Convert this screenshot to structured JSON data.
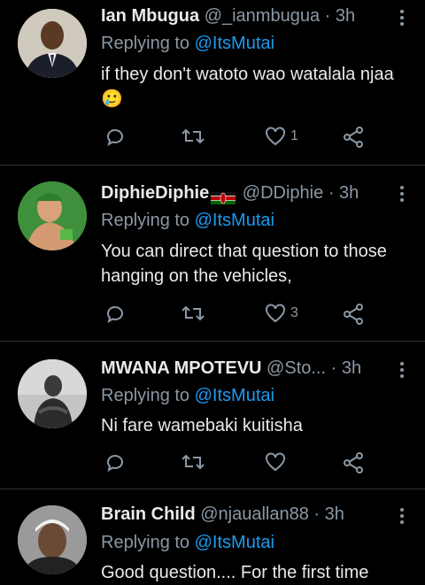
{
  "reply_prefix": "Replying to",
  "tweets": [
    {
      "name": "Ian Mbugua",
      "handle": "@_ianmbugua",
      "time": "3h",
      "reply_to": "@ItsMutai",
      "text": "if they don't watoto wao watalala njaa🥲",
      "likes": "1"
    },
    {
      "name": "DiphieDiphie",
      "handle": "@DDiphie",
      "time": "3h",
      "reply_to": "@ItsMutai",
      "text": "You can direct that question to those hanging on the vehicles,",
      "likes": "3"
    },
    {
      "name": "MWANA MPOTEVU",
      "handle": "@Sto...",
      "time": "3h",
      "reply_to": "@ItsMutai",
      "text": "Ni fare wamebaki kuitisha",
      "likes": ""
    },
    {
      "name": "Brain Child",
      "handle": "@njauallan88",
      "time": "3h",
      "reply_to": "@ItsMutai",
      "text": "Good question.... For the first time",
      "likes": ""
    }
  ],
  "colors": {
    "background": "#000000",
    "muted": "#8b98a5",
    "link": "#1d9bf0",
    "text": "#e8eaed"
  },
  "icons": [
    "reply-icon",
    "retweet-icon",
    "like-icon",
    "share-icon",
    "more-options-icon"
  ]
}
